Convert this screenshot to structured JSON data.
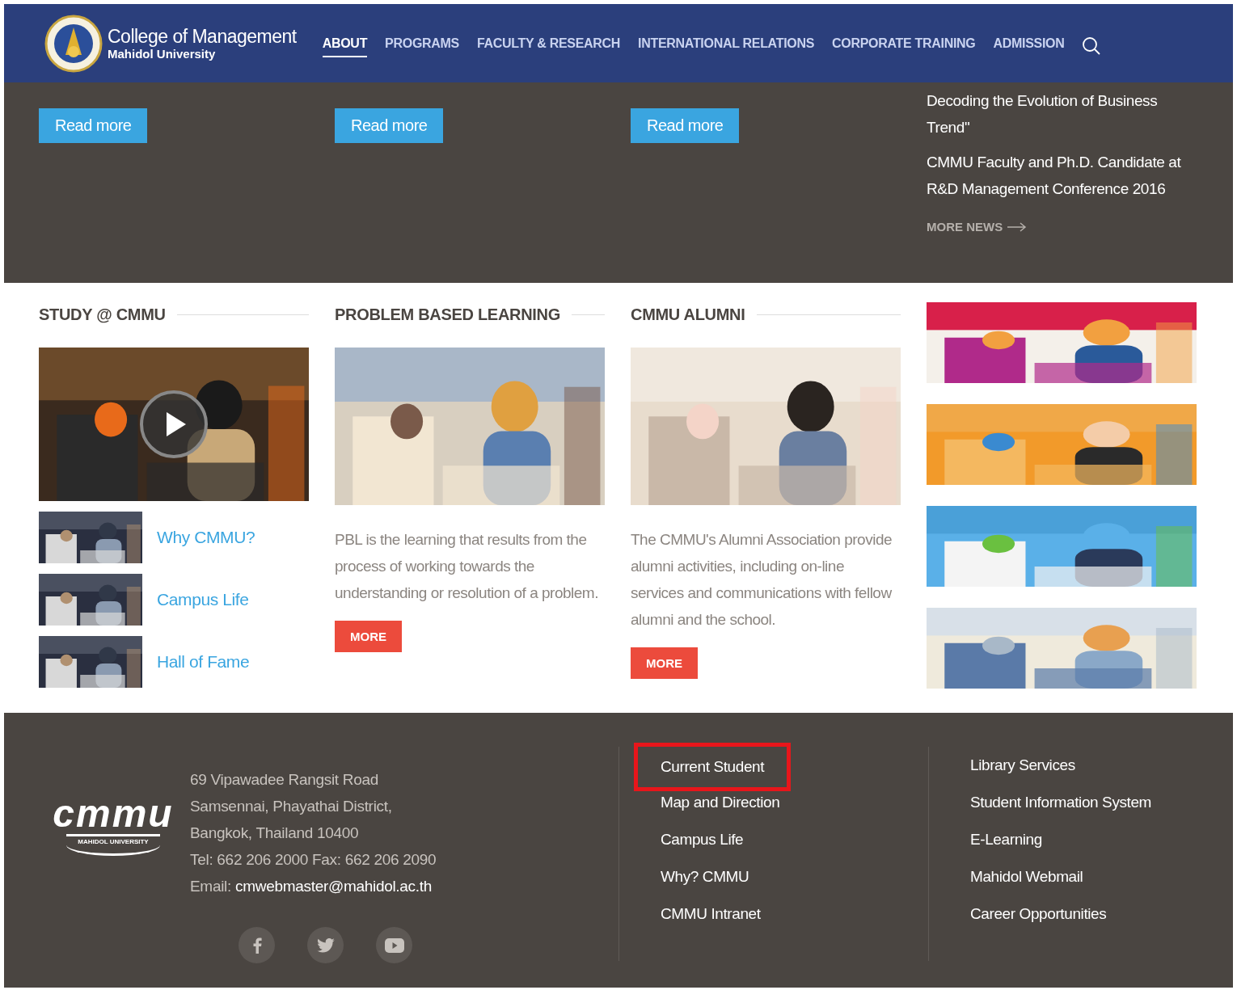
{
  "header": {
    "logo_title": "College of Management",
    "logo_subtitle": "Mahidol University",
    "nav": [
      {
        "label": "ABOUT",
        "selected": true
      },
      {
        "label": "PROGRAMS",
        "selected": false
      },
      {
        "label": "FACULTY & RESEARCH",
        "selected": false
      },
      {
        "label": "INTERNATIONAL RELATIONS",
        "selected": false
      },
      {
        "label": "CORPORATE TRAINING",
        "selected": false
      },
      {
        "label": "ADMISSION",
        "selected": false
      }
    ]
  },
  "hero": {
    "buttons": [
      "Read more",
      "Read more",
      "Read more"
    ],
    "news": [
      "Decoding the Evolution of Business Trend\"",
      "CMMU Faculty and Ph.D. Candidate at R&D Management Conference 2016"
    ],
    "more_news": "MORE NEWS"
  },
  "sections": [
    {
      "kind": "study",
      "heading": "STUDY @ CMMU",
      "links": [
        "Why CMMU?",
        "Campus Life",
        "Hall of Fame"
      ]
    },
    {
      "kind": "article",
      "heading": "PROBLEM BASED LEARNING",
      "text": "PBL is the learning that results from the process of working towards the understanding or resolution of a problem.",
      "button": "MORE"
    },
    {
      "kind": "article",
      "heading": "CMMU ALUMNI",
      "text": "The CMMU's Alumni Association provide alumni activities, including on-line services and communications with fellow alumni and the school.",
      "button": "MORE"
    }
  ],
  "footer": {
    "logo_text": "cmmu",
    "logo_subtext": "MAHIDOL UNIVERSITY",
    "address_lines": [
      "69 Vipawadee Rangsit Road",
      "Samsennai, Phayathai District,",
      "Bangkok, Thailand 10400",
      "Tel: 662 206 2000 Fax: 662 206 2090"
    ],
    "email_label": "Email:",
    "email": "cmwebmaster@mahidol.ac.th",
    "links_1": [
      {
        "label": "Current Student",
        "highlighted": true
      },
      {
        "label": "Map and Direction",
        "highlighted": false
      },
      {
        "label": "Campus Life",
        "highlighted": false
      },
      {
        "label": "Why? CMMU",
        "highlighted": false
      },
      {
        "label": "CMMU Intranet",
        "highlighted": false
      }
    ],
    "links_2": [
      {
        "label": "Library Services",
        "highlighted": false
      },
      {
        "label": "Student Information System",
        "highlighted": false
      },
      {
        "label": "E-Learning",
        "highlighted": false
      },
      {
        "label": "Mahidol Webmail",
        "highlighted": false
      },
      {
        "label": "Career Opportunities",
        "highlighted": false
      }
    ],
    "social": [
      {
        "kind": "facebook"
      },
      {
        "kind": "twitter"
      },
      {
        "kind": "youtube"
      }
    ]
  }
}
